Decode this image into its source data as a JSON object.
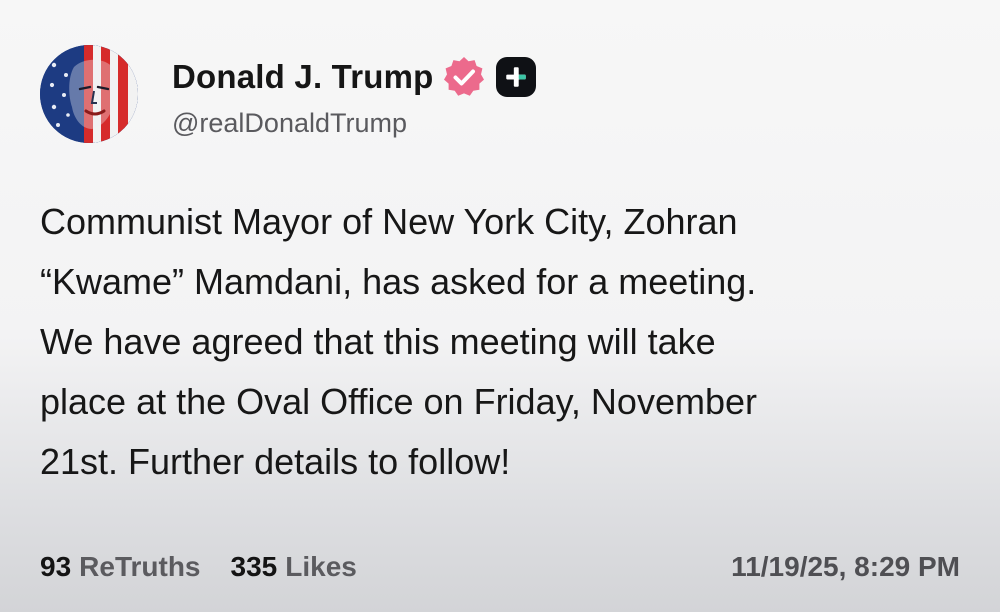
{
  "author": {
    "display_name": "Donald J. Trump",
    "handle": "@realDonaldTrump",
    "avatar_icon": "flag-portrait-avatar",
    "verified_icon": "verified-badge-icon",
    "plus_icon": "plus-badge-icon"
  },
  "post": {
    "lines": [
      "Communist Mayor of New York City, Zohran",
      "“Kwame” Mamdani, has asked for a meeting.",
      "We have agreed that this meeting will take",
      "place at the Oval Office on Friday, November",
      "21st. Further details to follow!"
    ]
  },
  "stats": {
    "retruths_count": "93",
    "retruths_label": "ReTruths",
    "likes_count": "335",
    "likes_label": "Likes"
  },
  "timestamp": "11/19/25, 8:29 PM",
  "colors": {
    "verified_badge": "#ec6a8c",
    "plus_badge": "#0f1115",
    "text_primary": "#141414",
    "text_secondary": "#5b5b5f"
  }
}
